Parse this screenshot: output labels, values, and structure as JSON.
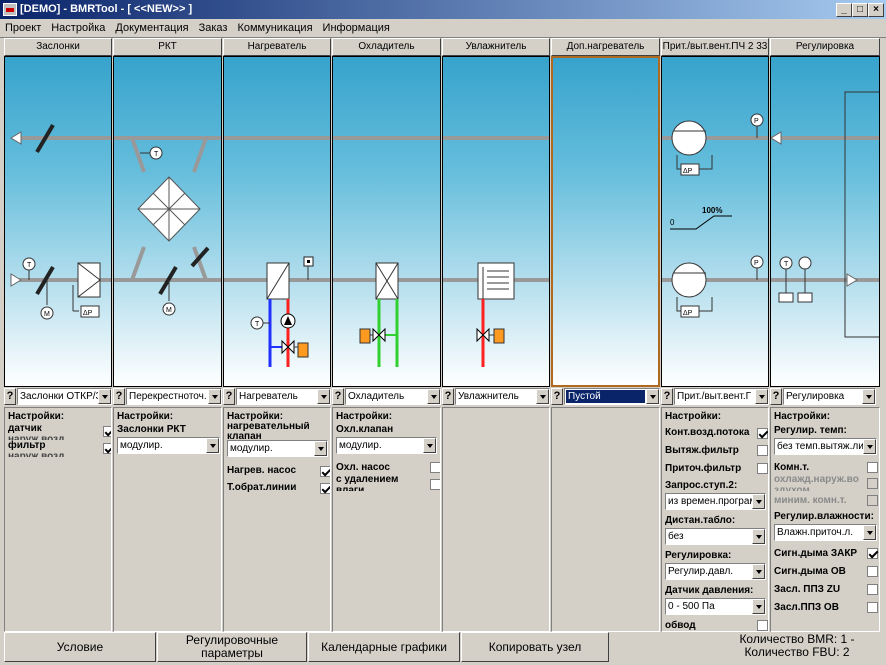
{
  "window": {
    "title": "[DEMO] - BMRTool - [ <<NEW>> ]",
    "btn_min": "_",
    "btn_max": "□",
    "btn_close": "×"
  },
  "menu": [
    "Проект",
    "Настройка",
    "Документация",
    "Заказ",
    "Коммуникация",
    "Информация"
  ],
  "columns": [
    {
      "header": "Заслонки",
      "select": "Заслонки ОТКР/З",
      "q": "?",
      "settings": {
        "title": "Настройки:",
        "rows": [
          {
            "label": "датчик",
            "sub": "наруж.возд.",
            "checked": true
          },
          {
            "label": "фильтр",
            "sub": "наруж.возд.",
            "checked": true
          }
        ]
      }
    },
    {
      "header": "РКТ",
      "select": "Перекрестноточ.",
      "q": "?",
      "settings": {
        "title": "Настройки:",
        "sub": "Заслонки РКТ",
        "dropdown": "модулир."
      }
    },
    {
      "header": "Нагреватель",
      "select": "Нагреватель",
      "q": "?",
      "settings": {
        "title": "Настройки:",
        "sub": "нагревательный клапан",
        "dropdown": "модулир.",
        "rows": [
          {
            "label": "Нагрев. насос",
            "checked": true
          },
          {
            "label": "Т.обрат.линии",
            "checked": true
          }
        ]
      }
    },
    {
      "header": "Охладитель",
      "select": "Охладитель",
      "q": "?",
      "settings": {
        "title": "Настройки:",
        "sub": "Охл.клапан",
        "dropdown": "модулир.",
        "rows": [
          {
            "label": "Охл. насос",
            "checked": false
          },
          {
            "label": "с удалением",
            "sub": "влаги",
            "checked": false
          }
        ]
      }
    },
    {
      "header": "Увлажнитель",
      "select": "Увлажнитель",
      "q": "?"
    },
    {
      "header": "Доп.нагреватель",
      "select": "Пустой",
      "q": "?"
    },
    {
      "header": "Прит./выт.вент.ПЧ 2 33",
      "select": "Прит./выт.вент.Г",
      "q": "?",
      "settings": {
        "title": "Настройки:",
        "rows": [
          {
            "label": "Конт.возд.потока",
            "checked": true
          },
          {
            "label": "Вытяж.фильтр",
            "checked": false
          },
          {
            "label": "Приточ.фильтр",
            "checked": false
          }
        ],
        "zapros_label": "Запрос.ступ.2:",
        "zapros_value": "из времен.программ",
        "distan_label": "Дистан.табло:",
        "distan_value": "без",
        "reg_label": "Регулировка:",
        "reg_value": "Регулир.давл.",
        "sensor_label": "Датчик давления:",
        "sensor_value": "0 - 500 Па",
        "bypass_label": "обвод",
        "bypass_checked": false
      }
    },
    {
      "header": "Регулировка",
      "select": "Регулировка",
      "q": "?",
      "settings": {
        "title": "Настройки:",
        "temp_label": "Регулир. темп:",
        "temp_value": "без темп.вытяж.ли",
        "komn_label": "Комн.т.",
        "komn_checked": false,
        "ohl_label": "охлажд.наруж.во",
        "ohl_sub": "здухом",
        "ohl_checked": false,
        "minim_label": "миним. комн.т.",
        "minim_checked": false,
        "hum_label": "Регулир.влажности:",
        "hum_value": "Влажн.приточ.л.",
        "rows": [
          {
            "label": "Сигн.дыма ЗАКР",
            "checked": true
          },
          {
            "label": "Сигн.дыма ОВ",
            "checked": false
          },
          {
            "label": "Засл. ППЗ ZU",
            "checked": false
          },
          {
            "label": "Засл.ППЗ ОВ",
            "checked": false
          }
        ]
      }
    }
  ],
  "diagram_labels": {
    "t": "T",
    "m": "M",
    "dp": "ΔP",
    "p": "P",
    "pct": "100%",
    "zero": "0"
  },
  "status": {
    "b1": "Условие",
    "b2a": "Регулировочные",
    "b2b": "параметры",
    "b3": "Календарные графики",
    "b4": "Копировать узел",
    "count_bmr": "Количество BMR: 1 -",
    "count_fbu": "Количество FBU: 2"
  }
}
